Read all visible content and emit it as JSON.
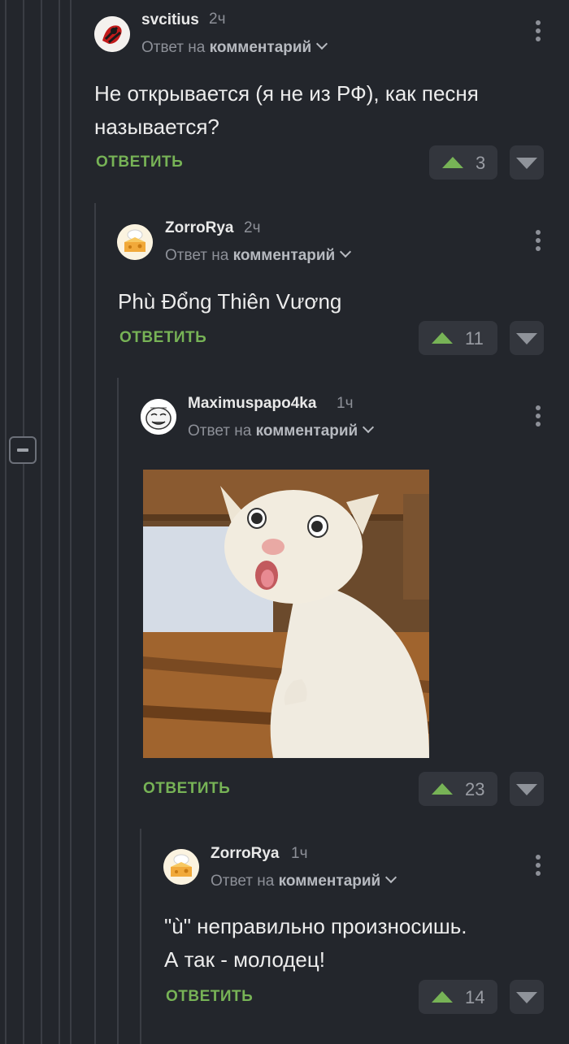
{
  "comments": [
    {
      "author": "svcitius",
      "time": "2ч",
      "reply_prefix": "Ответ на",
      "reply_target": "комментарий",
      "text": "Не открывается (я не из РФ), как песня называется?",
      "reply_label": "ОТВЕТИТЬ",
      "votes": "3",
      "avatar_icon": "samurai-avatar-icon"
    },
    {
      "author": "ZorroRya",
      "time": "2ч",
      "reply_prefix": "Ответ на",
      "reply_target": "комментарий",
      "text": "Phù Đổng Thiên Vương",
      "reply_label": "ОТВЕТИТЬ",
      "votes": "11",
      "avatar_icon": "cheese-chef-avatar-icon"
    },
    {
      "author": "Maximuspapo4ka",
      "time": "1ч",
      "reply_prefix": "Ответ на",
      "reply_target": "комментарий",
      "image": "coughing-cat-photo",
      "reply_label": "ОТВЕТИТЬ",
      "votes": "23",
      "avatar_icon": "meme-face-avatar-icon"
    },
    {
      "author": "ZorroRya",
      "time": "1ч",
      "reply_prefix": "Ответ на",
      "reply_target": "комментарий",
      "text_line1": "\"ù\" неправильно произносишь.",
      "text_line2": "А так - молодец!",
      "reply_label": "ОТВЕТИТЬ",
      "votes": "14",
      "avatar_icon": "cheese-chef-avatar-icon"
    }
  ],
  "colors": {
    "background": "#23262c",
    "accent_green": "#77b356",
    "vote_box": "#33363d",
    "muted_text": "#8d9098"
  }
}
